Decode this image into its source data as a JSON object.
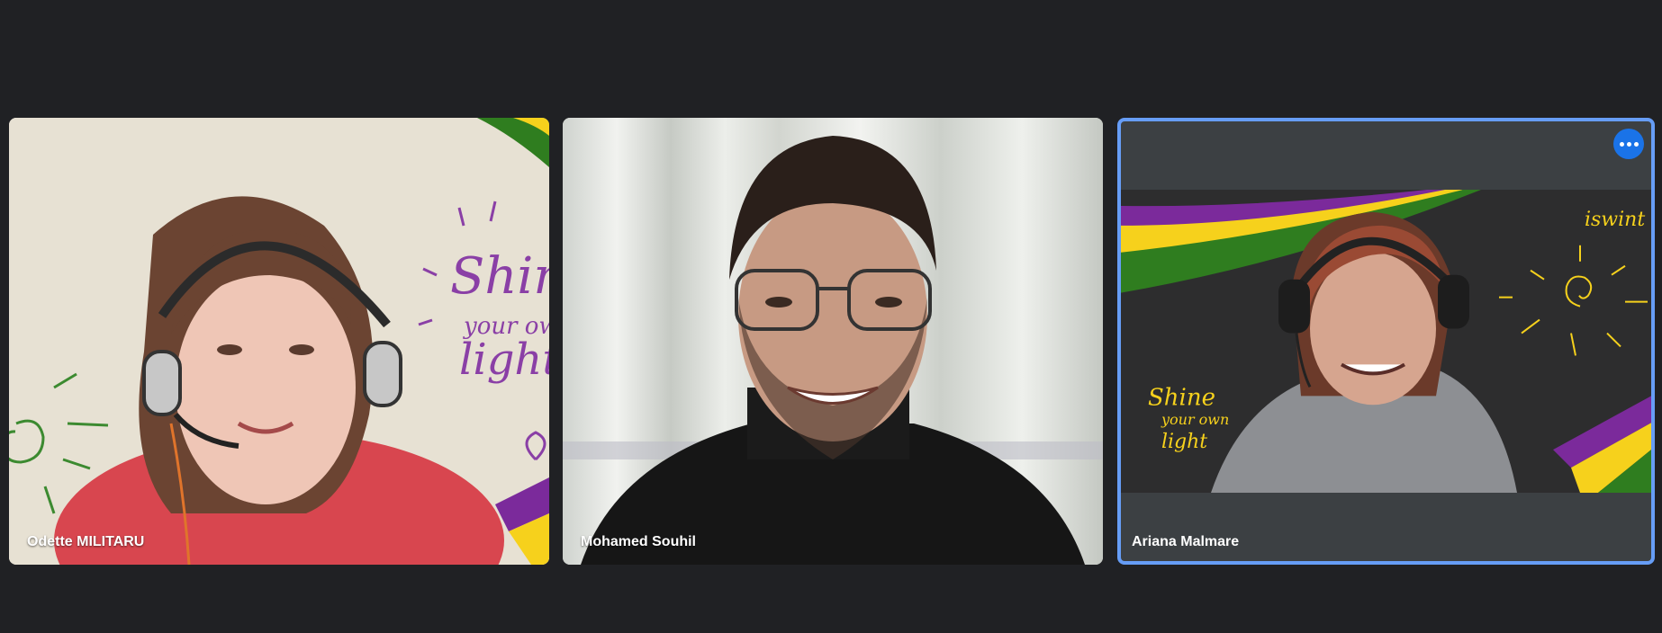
{
  "participants": [
    {
      "name": "Odette MILITARU"
    },
    {
      "name": "Mohamed Souhil"
    },
    {
      "name": "Ariana Malmare",
      "more_options_icon": "more-horiz-icon"
    }
  ],
  "backgrounds": {
    "tile1_text_line1": "Shine",
    "tile1_text_line2": "your own",
    "tile1_text_line3": "light",
    "tile3_logo": "iswint",
    "tile3_text_line1": "Shine",
    "tile3_text_line2": "your own",
    "tile3_text_line3": "light"
  },
  "colors": {
    "page_bg": "#202124",
    "active_border": "#669df6",
    "menu_button": "#1a73e8",
    "brand_purple": "#7b2a9b",
    "brand_yellow": "#f6d11c",
    "brand_green": "#2f7d1f"
  }
}
